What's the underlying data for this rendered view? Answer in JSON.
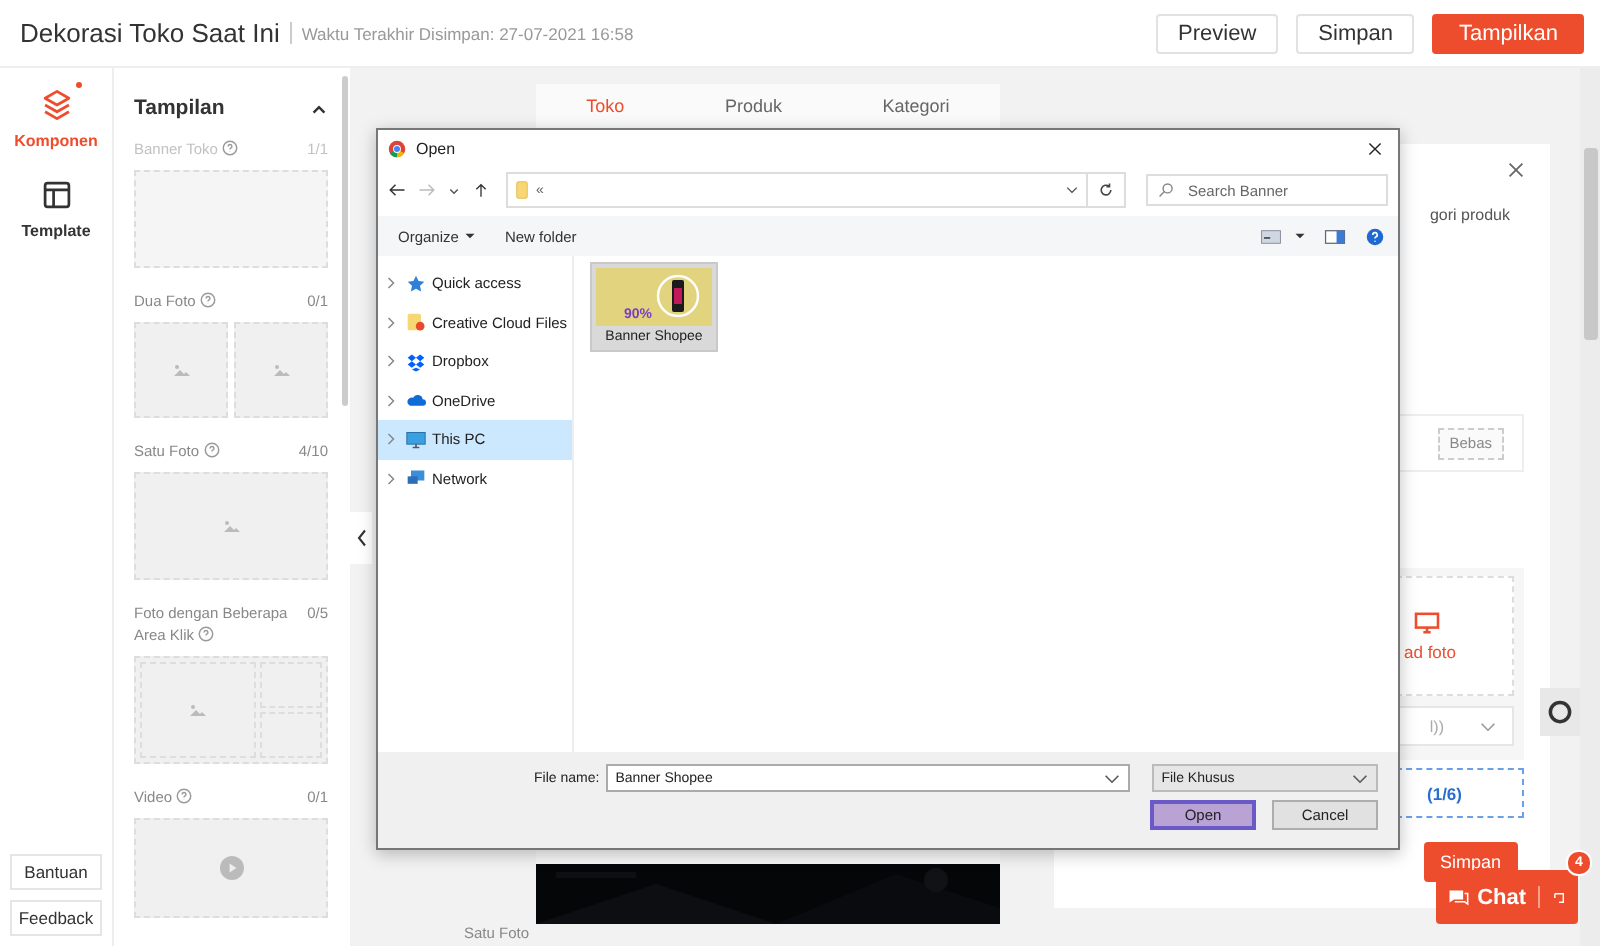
{
  "header": {
    "title": "Dekorasi Toko Saat Ini",
    "saved_time": "Waktu Terakhir Disimpan: 27-07-2021 16:58",
    "buttons": [
      {
        "label": "Preview",
        "kind": "plain"
      },
      {
        "label": "Simpan",
        "kind": "plain"
      },
      {
        "label": "Tampilkan",
        "kind": "primary"
      }
    ]
  },
  "rail": {
    "items": [
      {
        "label": "Komponen",
        "selected": true,
        "dot": true
      },
      {
        "label": "Template",
        "selected": false,
        "dot": false
      }
    ],
    "buttons": [
      "Bantuan",
      "Feedback"
    ]
  },
  "panel": {
    "title": "Tampilan",
    "sections": [
      {
        "label": "Banner Toko",
        "count": "1/1",
        "kind": "banner",
        "disabled": true
      },
      {
        "label": "Dua Foto",
        "count": "0/1",
        "kind": "two",
        "disabled": false
      },
      {
        "label": "Satu Foto",
        "count": "4/10",
        "kind": "one",
        "disabled": false
      },
      {
        "label": "Foto dengan Beberapa Area Klik",
        "count": "0/5",
        "kind": "multi",
        "disabled": false
      },
      {
        "label": "Video",
        "count": "0/1",
        "kind": "video",
        "disabled": false
      }
    ]
  },
  "preview": {
    "tabs": [
      {
        "label": "Toko",
        "selected": true
      },
      {
        "label": "Produk",
        "selected": false
      },
      {
        "label": "Kategori",
        "selected": false
      }
    ],
    "side_label": "Satu Foto"
  },
  "side_card": {
    "description": "gori produk",
    "ratio_button": "Bebas",
    "upload_label": "ad foto",
    "select_value": "l))",
    "add_button": "(1/6)"
  },
  "floating": {
    "save": "Simpan",
    "chat": "Chat",
    "chat_badge": "4"
  },
  "dialog": {
    "title": "Open",
    "path": "«",
    "search": {
      "placeholder": "Search Banner"
    },
    "toolbar": [
      {
        "label": "Organize",
        "dropdown": true
      },
      {
        "label": "New folder",
        "dropdown": false
      }
    ],
    "nav": [
      {
        "label": "Quick access",
        "selected": false
      },
      {
        "label": "Creative Cloud Files",
        "selected": false
      },
      {
        "label": "Dropbox",
        "selected": false
      },
      {
        "label": "OneDrive",
        "selected": false
      },
      {
        "label": "This PC",
        "selected": true
      },
      {
        "label": "Network",
        "selected": false
      }
    ],
    "files": [
      {
        "name": "Banner Shopee",
        "thumb_text": "90%",
        "selected": true
      }
    ],
    "file_name_label": "File name:",
    "file_name": "Banner Shopee",
    "file_type": "File Khusus",
    "buttons": [
      {
        "label": "Open",
        "kind": "default"
      },
      {
        "label": "Cancel",
        "kind": "plain"
      }
    ]
  }
}
